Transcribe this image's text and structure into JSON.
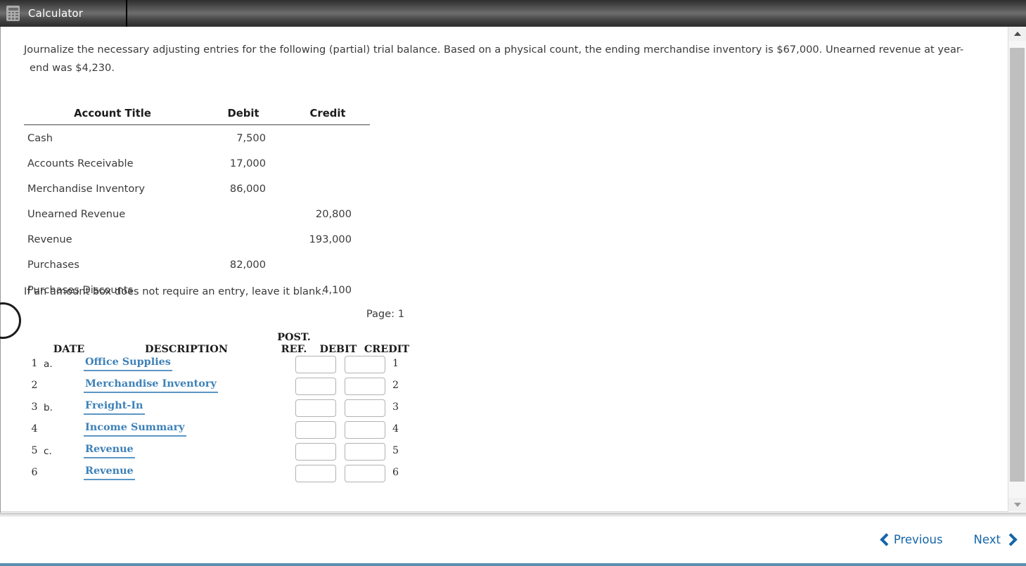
{
  "toolbar": {
    "tab_label": "Calculator",
    "icon": "calculator-icon"
  },
  "problem": {
    "intro_line1": "Journalize the necessary adjusting entries for the following (partial) trial balance. Based on a physical count, the ending merchandise inventory is $67,000. Unearned revenue at year-",
    "intro_line2": "end was $4,230.",
    "hint": "If an amount box does not require an entry, leave it blank.",
    "page_label": "Page: 1"
  },
  "trial_balance": {
    "headers": [
      "Account Title",
      "Debit",
      "Credit"
    ],
    "rows": [
      {
        "title": "Cash",
        "debit": "7,500",
        "credit": ""
      },
      {
        "title": "Accounts Receivable",
        "debit": "17,000",
        "credit": ""
      },
      {
        "title": "Merchandise Inventory",
        "debit": "86,000",
        "credit": ""
      },
      {
        "title": "Unearned Revenue",
        "debit": "",
        "credit": "20,800"
      },
      {
        "title": "Revenue",
        "debit": "",
        "credit": "193,000"
      },
      {
        "title": "Purchases",
        "debit": "82,000",
        "credit": ""
      },
      {
        "title": "Purchases Discounts",
        "debit": "",
        "credit": "4,100"
      }
    ]
  },
  "journal": {
    "headers": {
      "date": "DATE",
      "description": "DESCRIPTION",
      "post_ref_line1": "POST.",
      "post_ref_line2": "REF.",
      "debit": "DEBIT",
      "credit": "CREDIT"
    },
    "rows": [
      {
        "line": "1",
        "ref": "a.",
        "description": "Office Supplies",
        "debit": "",
        "credit": "",
        "line_right": "1"
      },
      {
        "line": "2",
        "ref": "",
        "description": "Merchandise Inventory",
        "debit": "",
        "credit": "",
        "line_right": "2"
      },
      {
        "line": "3",
        "ref": "b.",
        "description": "Freight-In",
        "debit": "",
        "credit": "",
        "line_right": "3"
      },
      {
        "line": "4",
        "ref": "",
        "description": "Income Summary",
        "debit": "",
        "credit": "",
        "line_right": "4"
      },
      {
        "line": "5",
        "ref": "c.",
        "description": "Revenue",
        "debit": "",
        "credit": "",
        "line_right": "5"
      },
      {
        "line": "6",
        "ref": "",
        "description": "Revenue",
        "debit": "",
        "credit": "",
        "line_right": "6"
      }
    ]
  },
  "footer": {
    "previous_label": "Previous",
    "next_label": "Next"
  },
  "colors": {
    "link_blue": "#3d81b8",
    "nav_blue": "#1565a8",
    "accent_bottom": "#5b8fae",
    "toolbar_dark": "#4a4a4a"
  }
}
